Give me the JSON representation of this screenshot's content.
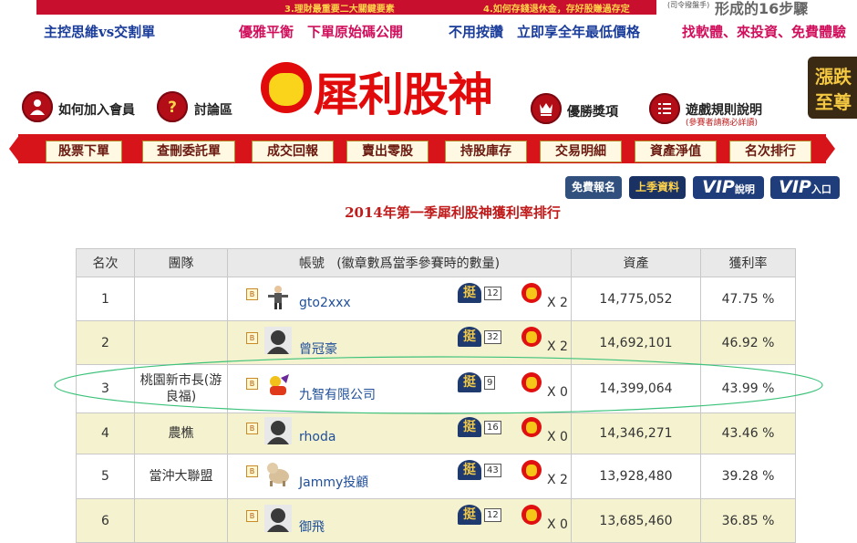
{
  "top_banner": {
    "item3": "3.理財最重要二大關鍵要素",
    "item4": "4.如何存錢退休金，存好股賺過存定",
    "note": "(司令撥盤手)",
    "big_text": "形成的16步驟"
  },
  "promo_links": [
    {
      "label": "主控思維vs交割單",
      "color": "#1a3c9a"
    },
    {
      "label": "優雅平衡　下單原始碼公開",
      "color": "#d0105c"
    },
    {
      "label": "不用按讚　立即享全年最低價格",
      "color": "#1a3c9a"
    },
    {
      "label": "找軟體、來投資、免費體驗",
      "color": "#d0105c"
    }
  ],
  "logo": {
    "text": "犀利股神"
  },
  "top_nav": {
    "join": "如何加入會員",
    "forum": "討論區",
    "prize": "優勝獎項",
    "rules": "遊戲規則說明",
    "rules_note": "(參賽者請務必詳讀)"
  },
  "corner_badge": {
    "line1": "漲跌",
    "line2": "至尊"
  },
  "main_nav": [
    "股票下單",
    "查刪委託單",
    "成交回報",
    "賣出零股",
    "持股庫存",
    "交易明細",
    "資產淨值",
    "名次排行"
  ],
  "sub_buttons": {
    "free_signup": "免費報名",
    "last_season": "上季資料",
    "vip": "VIP",
    "vip_info": "說明",
    "vip_enter": "入口"
  },
  "page_title": "2014年第一季犀利股神獲利率排行",
  "table": {
    "headers": {
      "rank": "名次",
      "team": "團隊",
      "account": "帳號",
      "account_note": "(徽章數爲當季參賽時的數量)",
      "assets": "資產",
      "profit": "獲利率"
    },
    "badge_label": "挺",
    "medal_prefix": "X ",
    "b_label": "B",
    "rows": [
      {
        "rank": "1",
        "team": "",
        "account": "gto2xxx",
        "badges": "12",
        "medals": "X 2",
        "assets": "14,775,052",
        "profit": "47.75 %"
      },
      {
        "rank": "2",
        "team": "",
        "account": "曾冠豪",
        "badges": "32",
        "medals": "X 2",
        "assets": "14,692,101",
        "profit": "46.92 %"
      },
      {
        "rank": "3",
        "team": "桃園新市長(游良福)",
        "account": "九智有限公司",
        "badges": "9",
        "medals": "X 0",
        "assets": "14,399,064",
        "profit": "43.99 %"
      },
      {
        "rank": "4",
        "team": "農樵",
        "account": "rhoda",
        "badges": "16",
        "medals": "X 0",
        "assets": "14,346,271",
        "profit": "43.46 %"
      },
      {
        "rank": "5",
        "team": "當沖大聯盟",
        "account": "Jammy投顧",
        "badges": "43",
        "medals": "X 2",
        "assets": "13,928,480",
        "profit": "39.28 %"
      },
      {
        "rank": "6",
        "team": "",
        "account": "御飛",
        "badges": "12",
        "medals": "X 0",
        "assets": "13,685,460",
        "profit": "36.85 %"
      }
    ]
  },
  "colors": {
    "brand_red": "#d7141a",
    "title_red": "#c01a1a",
    "link_blue": "#1f4f9a",
    "row_alt": "#f5f2cf",
    "highlight": "#3cc27a"
  }
}
